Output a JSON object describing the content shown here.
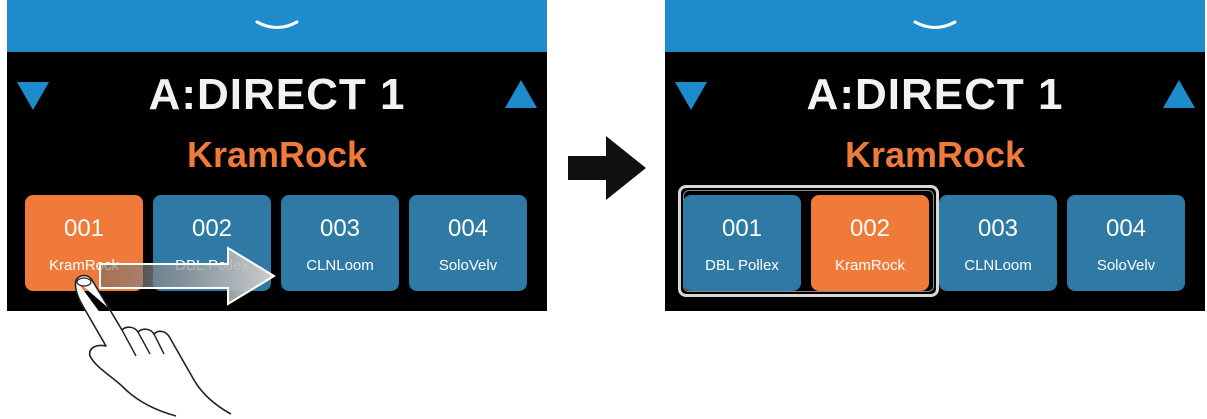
{
  "before": {
    "bank": "A:DIRECT 1",
    "patch": "KramRock",
    "slots": [
      {
        "num": "001",
        "name": "KramRock",
        "active": true
      },
      {
        "num": "002",
        "name": "DBL Pollex",
        "active": false
      },
      {
        "num": "003",
        "name": "CLNLoom",
        "active": false
      },
      {
        "num": "004",
        "name": "SoloVelv",
        "active": false
      }
    ]
  },
  "after": {
    "bank": "A:DIRECT 1",
    "patch": "KramRock",
    "slots": [
      {
        "num": "001",
        "name": "DBL Pollex",
        "active": false
      },
      {
        "num": "002",
        "name": "KramRock",
        "active": true
      },
      {
        "num": "003",
        "name": "CLNLoom",
        "active": false
      },
      {
        "num": "004",
        "name": "SoloVelv",
        "active": false
      }
    ]
  },
  "icons": {
    "topbar": "chevron-down-icon",
    "nav_prev": "triangle-down-icon",
    "nav_next": "triangle-up-icon",
    "gesture": "swipe-hand-icon",
    "transition": "arrow-right-icon"
  },
  "colors": {
    "accent_blue": "#1e8ccc",
    "slot_blue": "#2e7aa4",
    "active_orange": "#f07a3a",
    "screen_bg": "#000000",
    "bank_text": "#f2f2f2"
  }
}
